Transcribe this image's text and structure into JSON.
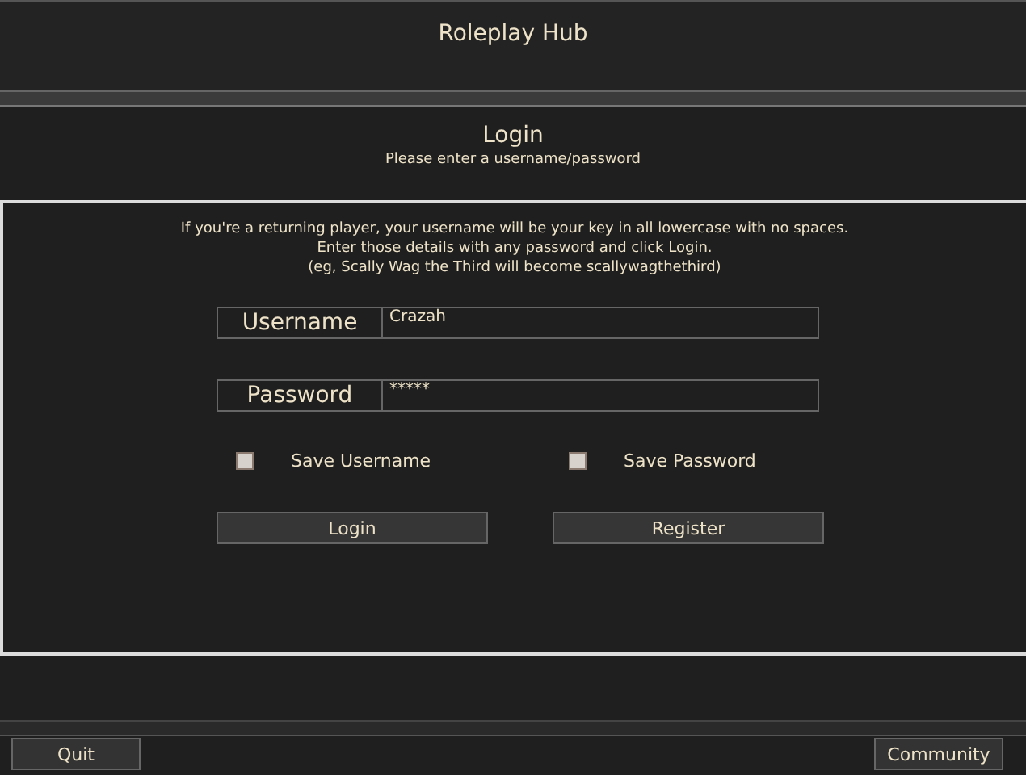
{
  "window": {
    "title": "Roleplay Hub"
  },
  "login": {
    "title": "Login",
    "subtitle": "Please enter a username/password"
  },
  "instructions": [
    "If you're a returning player, your username will be your key in all lowercase with no spaces.",
    "Enter those details with any password and click Login.",
    "(eg, Scally Wag the Third will become scallywagthethird)"
  ],
  "fields": [
    {
      "label": "Username",
      "value": "Crazah"
    },
    {
      "label": "Password",
      "value": "*****"
    }
  ],
  "checkboxes": [
    {
      "label": "Save Username",
      "checked": false
    },
    {
      "label": "Save Password",
      "checked": false
    }
  ],
  "buttons": [
    "Login",
    "Register"
  ],
  "footer": {
    "left_button": "Quit",
    "right_button": "Community"
  }
}
